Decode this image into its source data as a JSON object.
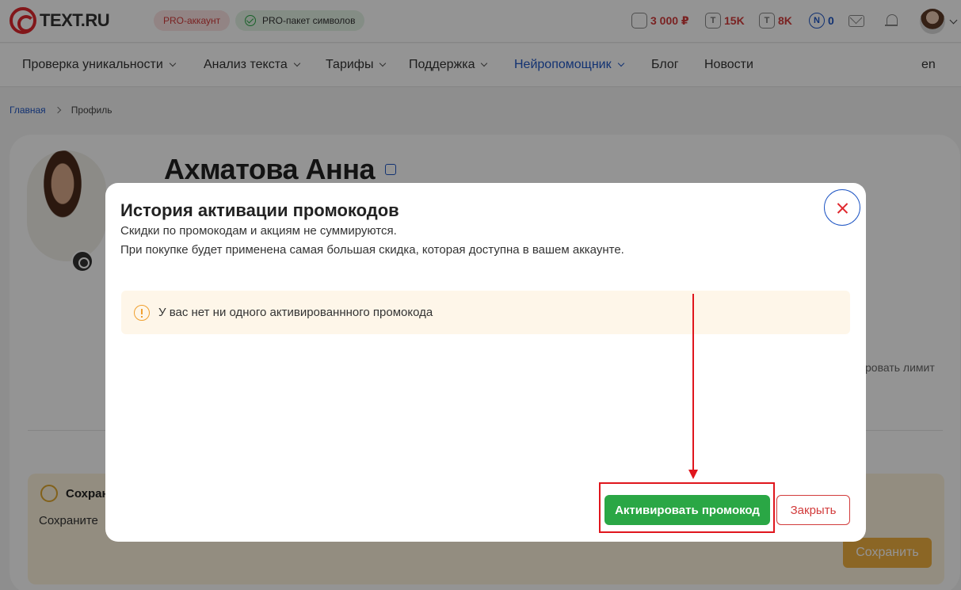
{
  "header": {
    "logo_text": "TEXT.RU",
    "badge_pro": "PRO-аккаунт",
    "badge_pack": "PRO-пакет символов",
    "balance": "3 000 ₽",
    "stat1": "15K",
    "stat2": "8K",
    "stat3": "0",
    "stat_icon_letter": "T",
    "stat_icon_n": "N"
  },
  "nav": {
    "items": [
      {
        "label": "Проверка уникальности"
      },
      {
        "label": "Анализ текста"
      },
      {
        "label": "Тарифы"
      },
      {
        "label": "Поддержка"
      },
      {
        "label": "Нейропомощник"
      },
      {
        "label": "Блог"
      },
      {
        "label": "Новости"
      }
    ],
    "lang": "en",
    "active_color": "#1f56c4"
  },
  "breadcrumb": {
    "home": "Главная",
    "current": "Профиль"
  },
  "profile": {
    "name": "Ахматова Анна",
    "limit_text": "ровать лимит",
    "save_title": "Сохран",
    "save_text": "Сохраните",
    "save_button": "Сохранить"
  },
  "modal": {
    "title": "История активации промокодов",
    "subtitle1": "Скидки по промокодам и акциям не суммируются.",
    "subtitle2": "При покупке будет применена самая большая скидка, которая доступна в вашем аккаунте.",
    "notice": "У вас нет ни одного активированнного промокода",
    "activate_button": "Активировать промокод",
    "close_button": "Закрыть"
  },
  "colors": {
    "brand_red": "#e0282e",
    "green": "#2aa745",
    "blue": "#1f56c4",
    "warning": "#f0a030"
  }
}
